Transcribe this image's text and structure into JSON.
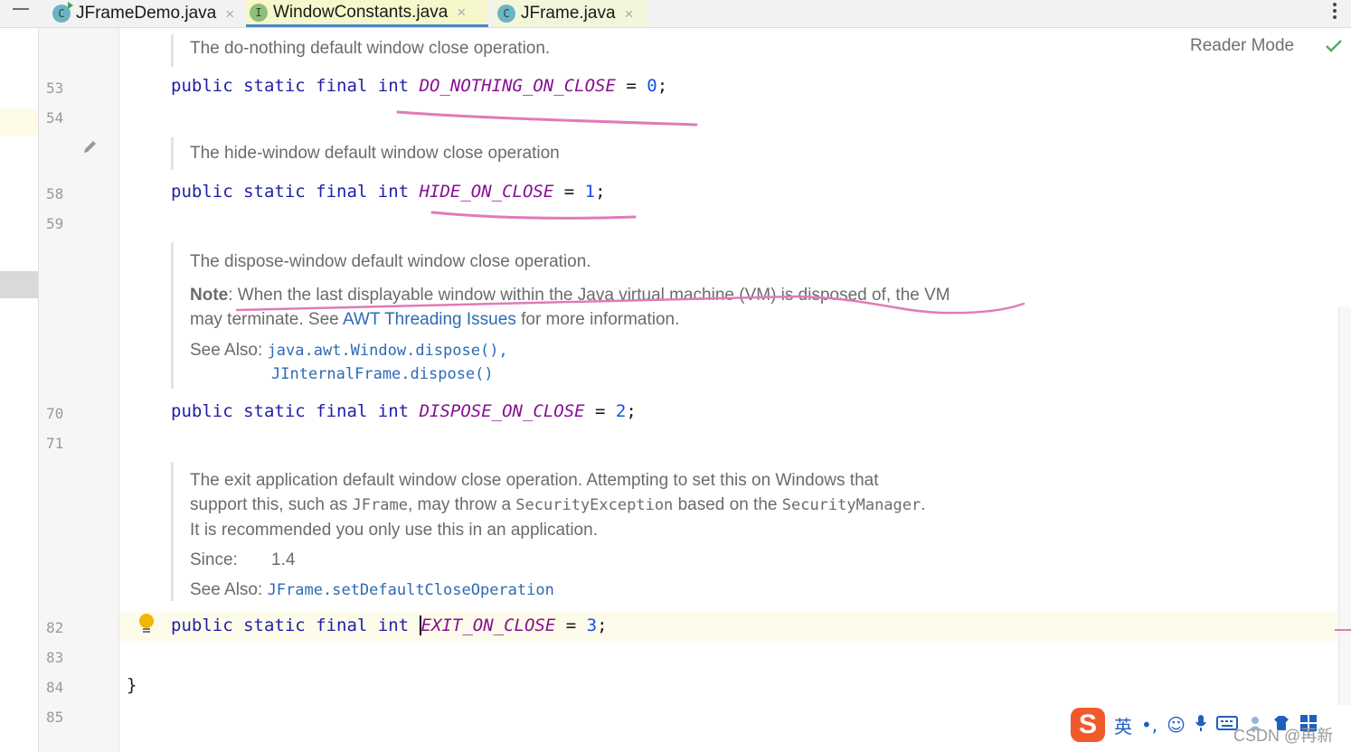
{
  "tabs": [
    {
      "label": "JFrameDemo.java",
      "icon": "class-run-icon",
      "close": "×"
    },
    {
      "label": "WindowConstants.java",
      "icon": "interface-icon",
      "close": "×"
    },
    {
      "label": "JFrame.java",
      "icon": "class-icon",
      "close": "×"
    }
  ],
  "tab_icon_letters": {
    "class": "C",
    "interface": "I"
  },
  "editor": {
    "reader_mode": "Reader Mode",
    "line_numbers": [
      "53",
      "54",
      "58",
      "59",
      "70",
      "71",
      "82",
      "83",
      "84",
      "85"
    ],
    "doc1": "The do-nothing default window close operation.",
    "code53": {
      "kw": "public static final int",
      "name": "DO_NOTHING_ON_CLOSE",
      "eq": " = ",
      "value": "0",
      "end": ";"
    },
    "doc2": "The hide-window default window close operation",
    "code58": {
      "kw": "public static final int",
      "name": "HIDE_ON_CLOSE",
      "eq": " = ",
      "value": "1",
      "end": ";"
    },
    "doc3": {
      "line1": "The dispose-window default window close operation.",
      "note_label": "Note",
      "note_text": ": When the last displayable window within the Java virtual machine (VM) is disposed of, the VM",
      "note_text2": "may terminate. See ",
      "note_link": "AWT Threading Issues",
      "note_tail": " for more information.",
      "see_also_label": "See Also:",
      "see_also_1": "java.awt.Window.dispose(),",
      "see_also_2": "JInternalFrame.dispose()"
    },
    "code70": {
      "kw": "public static final int",
      "name": "DISPOSE_ON_CLOSE",
      "eq": " = ",
      "value": "2",
      "end": ";"
    },
    "doc4": {
      "line1": "The exit application default window close operation. Attempting to set this on Windows that",
      "line2a": "support this, such as ",
      "line2b": "JFrame",
      "line2c": ", may throw a ",
      "line2d": "SecurityException",
      "line2e": " based on the ",
      "line2f": "SecurityManager",
      "line2g": ".",
      "line3": "It is recommended you only use this in an application.",
      "since_label": "Since:",
      "since_value": "1.4",
      "see_also_label": "See Also:",
      "see_also_1": "JFrame.setDefaultCloseOperation"
    },
    "code82": {
      "kw": "public static final int",
      "name": "EXIT_ON_CLOSE",
      "eq": " = ",
      "value": "3",
      "end": ";"
    },
    "code84": "}"
  },
  "ime": {
    "logo": "S",
    "lang": "英",
    "punct": "•,"
  },
  "watermark": "CSDN @再新",
  "colors": {
    "keyword": "#1f1fa6",
    "constant": "#871094",
    "number": "#1750eb",
    "annotation": "#e07bb8",
    "doc_link": "#2e6ab3"
  }
}
